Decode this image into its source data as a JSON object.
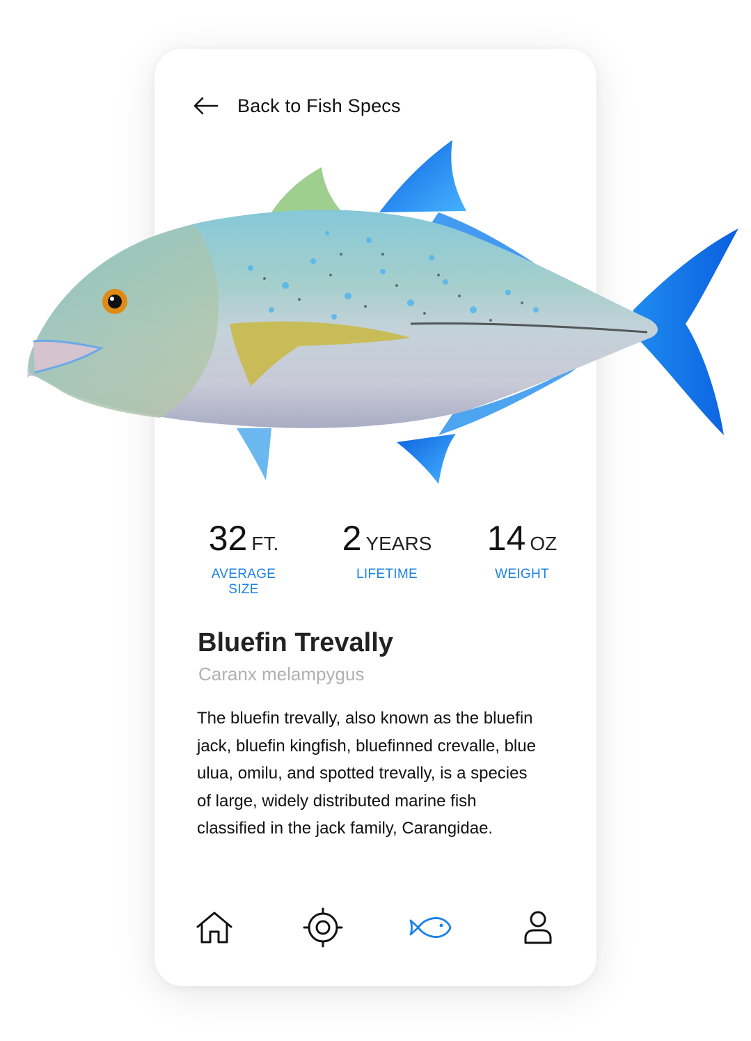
{
  "header": {
    "back_label": "Back to Fish Specs",
    "back_icon": "arrow-left-icon"
  },
  "fish": {
    "common_name": "Bluefin Trevally",
    "scientific_name": "Caranx melampygus",
    "description": "The bluefin trevally, also known as the bluefin jack, bluefin kingfish, bluefinned crevalle, blue ulua, omilu, and spotted trevally, is a species of large, widely distributed marine fish classified in the jack family, Carangidae."
  },
  "stats": [
    {
      "value": "32",
      "unit": "FT.",
      "label": "AVERAGE SIZE"
    },
    {
      "value": "2",
      "unit": "YEARS",
      "label": "LIFETIME"
    },
    {
      "value": "14",
      "unit": "OZ",
      "label": "WEIGHT"
    }
  ],
  "nav": {
    "items": [
      {
        "icon": "home-icon",
        "active": false
      },
      {
        "icon": "target-icon",
        "active": false
      },
      {
        "icon": "fish-icon",
        "active": true
      },
      {
        "icon": "user-icon",
        "active": false
      }
    ]
  },
  "colors": {
    "accent": "#1a82e8",
    "text": "#111111",
    "muted": "#b0b0b0",
    "card": "#ffffff"
  }
}
